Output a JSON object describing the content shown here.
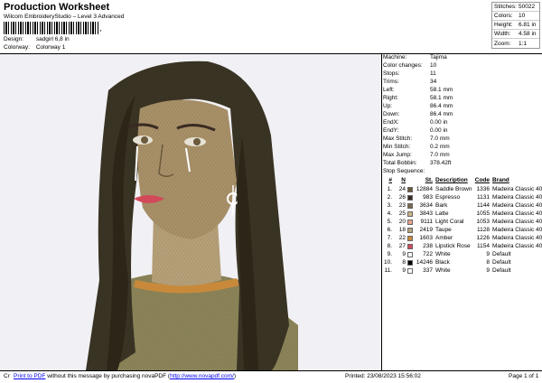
{
  "header": {
    "title": "Production Worksheet",
    "subtitle": "Wilcom EmbroideryStudio – Level 3 Advanced",
    "barcode_suffix": ",",
    "design_label": "Design:",
    "design_value": "sadgirl 6,8 in",
    "colorway_label": "Colorway:",
    "colorway_value": "Colorway 1"
  },
  "stats": [
    {
      "label": "Stitches:",
      "value": "50022"
    },
    {
      "label": "Colors:",
      "value": "10"
    },
    {
      "label": "Height:",
      "value": "6.81 in"
    },
    {
      "label": "Width:",
      "value": "4.58 in"
    },
    {
      "label": "Zoom:",
      "value": "1:1"
    }
  ],
  "info": [
    {
      "label": "Machine:",
      "value": "Tajima"
    },
    {
      "label": "Color changes:",
      "value": "10"
    },
    {
      "label": "Stops:",
      "value": "11"
    },
    {
      "label": "Trims:",
      "value": "34"
    },
    {
      "label": "Left:",
      "value": "58.1 mm"
    },
    {
      "label": "Right:",
      "value": "58.1 mm"
    },
    {
      "label": "Up:",
      "value": "86.4 mm"
    },
    {
      "label": "Down:",
      "value": "86.4 mm"
    },
    {
      "label": "EndX:",
      "value": "0.00 in"
    },
    {
      "label": "EndY:",
      "value": "0.00 in"
    },
    {
      "label": "Max Stitch:",
      "value": "7.0 mm"
    },
    {
      "label": "Min Stitch:",
      "value": "0.2 mm"
    },
    {
      "label": "Max Jump:",
      "value": "7.0 mm"
    },
    {
      "label": "Total Bobbin:",
      "value": "378.42ft"
    }
  ],
  "sequence": {
    "title": "Stop Sequence:",
    "headers": {
      "num": "#",
      "n": "N",
      "st": "St.",
      "desc": "Description",
      "code": "Code",
      "brand": "Brand"
    },
    "rows": [
      {
        "num": "1.",
        "code": "24",
        "color": "#6b5a3c",
        "st": "12884",
        "desc": "Saddle Brown",
        "ccode": "1336",
        "brand": "Madeira Classic 40"
      },
      {
        "num": "2.",
        "code": "26",
        "color": "#3a2a22",
        "st": "983",
        "desc": "Espresso",
        "ccode": "1131",
        "brand": "Madeira Classic 40"
      },
      {
        "num": "3.",
        "code": "23",
        "color": "#7a6a50",
        "st": "3634",
        "desc": "Bark",
        "ccode": "1144",
        "brand": "Madeira Classic 40"
      },
      {
        "num": "4.",
        "code": "25",
        "color": "#c9b48a",
        "st": "3843",
        "desc": "Latte",
        "ccode": "1055",
        "brand": "Madeira Classic 40"
      },
      {
        "num": "5.",
        "code": "20",
        "color": "#e8a48c",
        "st": "9111",
        "desc": "Light Coral",
        "ccode": "1053",
        "brand": "Madeira Classic 40"
      },
      {
        "num": "6.",
        "code": "18",
        "color": "#b8a482",
        "st": "2419",
        "desc": "Taupe",
        "ccode": "1128",
        "brand": "Madeira Classic 40"
      },
      {
        "num": "7.",
        "code": "22",
        "color": "#c88a3a",
        "st": "1603",
        "desc": "Amber",
        "ccode": "1226",
        "brand": "Madeira Classic 40"
      },
      {
        "num": "8.",
        "code": "27",
        "color": "#d24a5a",
        "st": "238",
        "desc": "Lipstick Rose",
        "ccode": "1154",
        "brand": "Madeira Classic 40"
      },
      {
        "num": "9.",
        "code": "9",
        "color": "#ffffff",
        "st": "722",
        "desc": "White",
        "ccode": "9",
        "brand": "Default"
      },
      {
        "num": "10.",
        "code": "8",
        "color": "#000000",
        "st": "14246",
        "desc": "Black",
        "ccode": "8",
        "brand": "Default"
      },
      {
        "num": "11.",
        "code": "9",
        "color": "#ffffff",
        "st": "337",
        "desc": "White",
        "ccode": "9",
        "brand": "Default"
      }
    ]
  },
  "footer": {
    "cr": "Cr",
    "link1": "Print to PDF",
    "middle": " without this message by purchasing novaPDF (",
    "link2": "http://www.novapdf.com/",
    "end": ")",
    "printed": "Printed: 23/08/2023 15:56:02",
    "page": "Page 1 of 1"
  }
}
